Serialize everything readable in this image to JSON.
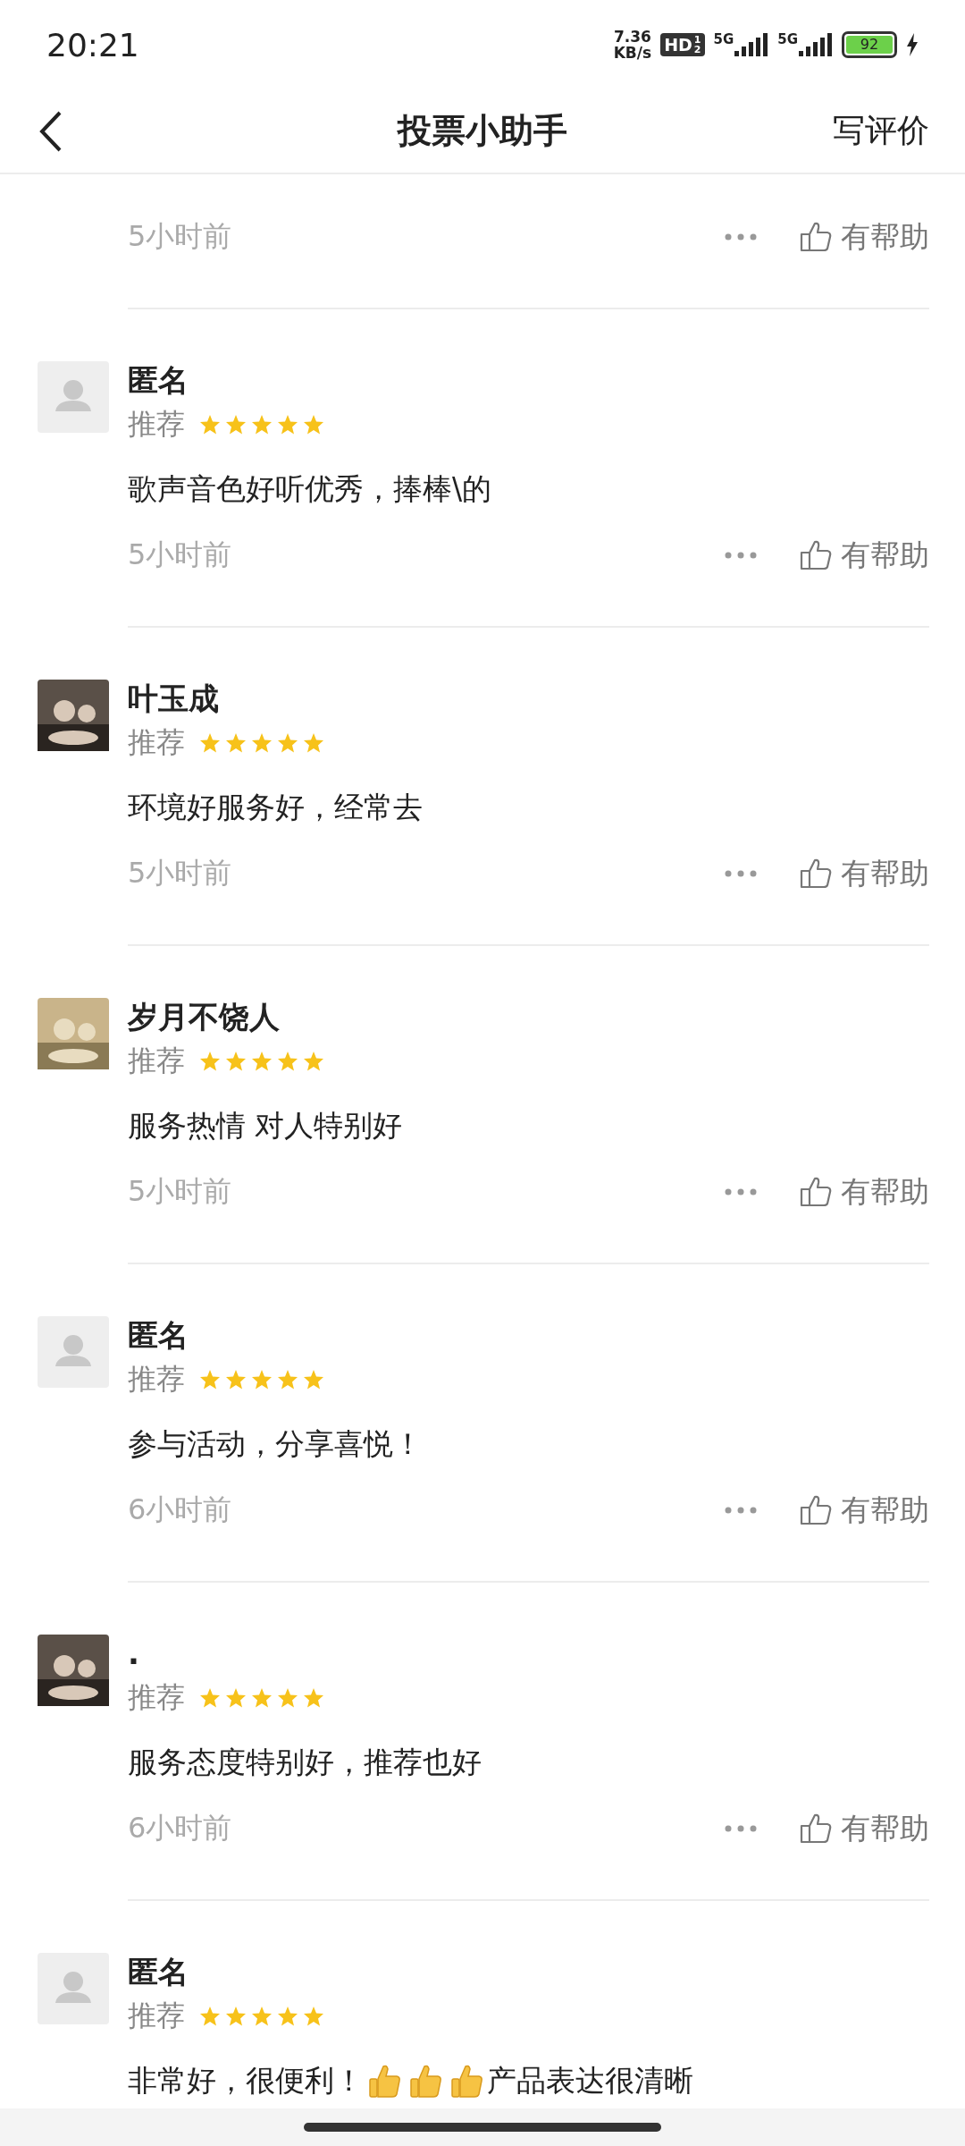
{
  "status_bar": {
    "time": "20:21",
    "net_speed": [
      "7.36",
      "KB/s"
    ],
    "hd": "HD",
    "hd_sub": [
      "1",
      "2"
    ],
    "signals": [
      "5G",
      "5G"
    ],
    "battery": "92",
    "charging": true
  },
  "header": {
    "title": "投票小助手",
    "action": "写评价"
  },
  "reviews": [
    {
      "time": "5小时前",
      "helpful": "有帮助"
    },
    {
      "name": "匿名",
      "avatar": {
        "kind": "default"
      },
      "tag": "推荐",
      "stars": 5,
      "comment": [
        {
          "kind": "text",
          "text": "歌声音色好听优秀，捧棒\\的"
        }
      ],
      "time": "5小时前",
      "helpful": "有帮助"
    },
    {
      "name": "叶玉成",
      "avatar": {
        "kind": "picture"
      },
      "tag": "推荐",
      "stars": 5,
      "comment": [
        {
          "kind": "text",
          "text": "环境好服务好，经常去"
        }
      ],
      "time": "5小时前",
      "helpful": "有帮助"
    },
    {
      "name": "岁月不饶人",
      "avatar": {
        "kind": "picture"
      },
      "tag": "推荐",
      "stars": 5,
      "comment": [
        {
          "kind": "text",
          "text": "服务热情 对人特别好"
        }
      ],
      "time": "5小时前",
      "helpful": "有帮助"
    },
    {
      "name": "匿名",
      "avatar": {
        "kind": "default"
      },
      "tag": "推荐",
      "stars": 5,
      "comment": [
        {
          "kind": "text",
          "text": "参与活动，分享喜悦！"
        }
      ],
      "time": "6小时前",
      "helpful": "有帮助"
    },
    {
      "name": ".",
      "avatar": {
        "kind": "picture"
      },
      "tag": "推荐",
      "stars": 5,
      "comment": [
        {
          "kind": "text",
          "text": "服务态度特别好，推荐也好"
        }
      ],
      "time": "6小时前",
      "helpful": "有帮助"
    },
    {
      "name": "匿名",
      "avatar": {
        "kind": "default"
      },
      "tag": "推荐",
      "stars": 5,
      "comment": [
        {
          "kind": "text",
          "text": "非常好，很便利！"
        },
        {
          "kind": "emoji"
        },
        {
          "kind": "emoji"
        },
        {
          "kind": "emoji"
        },
        {
          "kind": "text",
          "text": "产品表达很清晰"
        }
      ]
    }
  ]
}
